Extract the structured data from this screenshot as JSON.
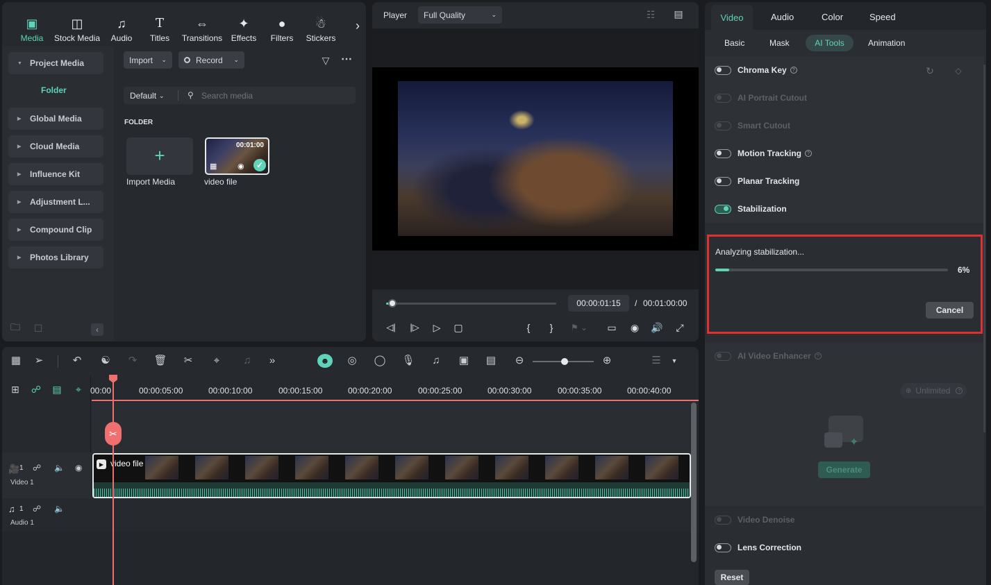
{
  "media": {
    "tabs": [
      {
        "label": "Media",
        "icon": "media-icon"
      },
      {
        "label": "Stock Media",
        "icon": "stock-media-icon"
      },
      {
        "label": "Audio",
        "icon": "music-note-icon"
      },
      {
        "label": "Titles",
        "icon": "titles-icon"
      },
      {
        "label": "Transitions",
        "icon": "transitions-icon"
      },
      {
        "label": "Effects",
        "icon": "effects-icon"
      },
      {
        "label": "Filters",
        "icon": "filters-icon"
      },
      {
        "label": "Stickers",
        "icon": "stickers-icon"
      }
    ],
    "nav": {
      "project_media": "Project Media",
      "folder": "Folder",
      "items": [
        "Global Media",
        "Cloud Media",
        "Influence Kit",
        "Adjustment L...",
        "Compound Clip",
        "Photos Library"
      ]
    },
    "import_label": "Import",
    "record_label": "Record",
    "sort_label": "Default",
    "search_placeholder": "Search media",
    "folder_heading": "FOLDER",
    "import_media_label": "Import Media",
    "clip": {
      "name": "video file",
      "duration": "00:01:00"
    }
  },
  "player": {
    "label": "Player",
    "quality": "Full Quality",
    "current_time": "00:00:01:15",
    "separator": "/",
    "total_time": "00:01:00:00",
    "progress": 0.02
  },
  "props": {
    "tabs": [
      "Video",
      "Audio",
      "Color",
      "Speed"
    ],
    "active_tab": "Video",
    "subtabs": [
      "Basic",
      "Mask",
      "AI Tools",
      "Animation"
    ],
    "active_subtab": "AI Tools",
    "rows": [
      {
        "label": "Chroma Key",
        "on": false,
        "disabled": false,
        "help": true
      },
      {
        "label": "AI Portrait Cutout",
        "on": false,
        "disabled": true,
        "help": false
      },
      {
        "label": "Smart Cutout",
        "on": false,
        "disabled": true,
        "help": false
      },
      {
        "label": "Motion Tracking",
        "on": false,
        "disabled": false,
        "help": true
      },
      {
        "label": "Planar Tracking",
        "on": false,
        "disabled": false,
        "help": false
      },
      {
        "label": "Stabilization",
        "on": true,
        "disabled": false,
        "help": false
      }
    ],
    "analyzing": {
      "text": "Analyzing stabilization...",
      "percent_label": "6%",
      "progress": 0.06,
      "cancel_label": "Cancel"
    },
    "enhancer": {
      "label": "AI Video Enhancer",
      "unlimited_label": "Unlimited",
      "generate_label": "Generate"
    },
    "video_denoise": "Video Denoise",
    "lens_correction": "Lens Correction",
    "reset_label": "Reset"
  },
  "timeline": {
    "ruler": [
      "00:00",
      "00:00:05:00",
      "00:00:10:00",
      "00:00:15:00",
      "00:00:20:00",
      "00:00:25:00",
      "00:00:30:00",
      "00:00:35:00",
      "00:00:40:00"
    ],
    "video_track": {
      "number": "1",
      "label": "Video 1"
    },
    "audio_track": {
      "number": "1",
      "label": "Audio 1"
    },
    "clip_label": "video file"
  },
  "colors": {
    "accent": "#5fd4b8",
    "playhead": "#f07070",
    "highlight": "#e03030"
  }
}
